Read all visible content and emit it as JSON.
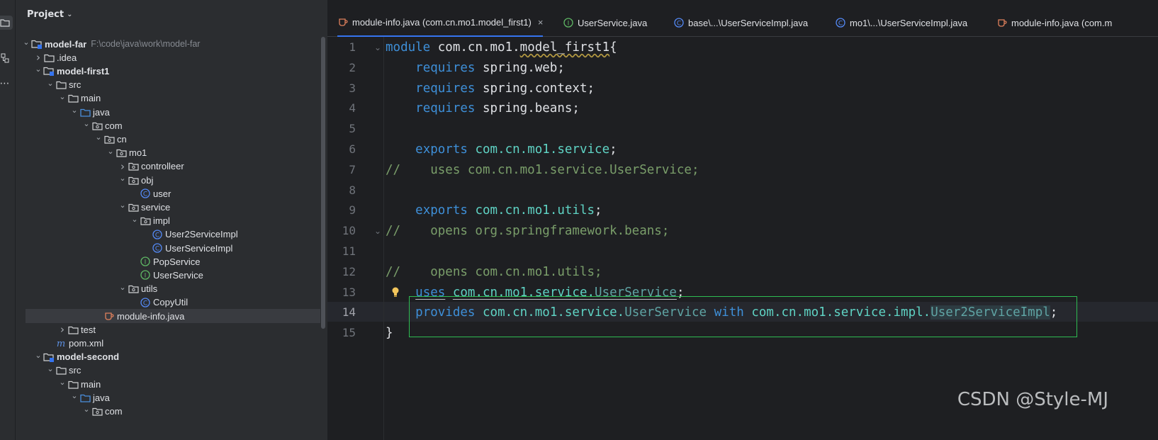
{
  "project_panel": {
    "title": "Project",
    "tree": [
      {
        "label": "model-far",
        "path": "F:\\code\\java\\work\\model-far",
        "icon": "module-folder-icon",
        "bold": true,
        "expanded": true,
        "depth": 0
      },
      {
        "label": ".idea",
        "icon": "folder-icon",
        "expanded": false,
        "depth": 1
      },
      {
        "label": "model-first1",
        "icon": "module-folder-icon",
        "bold": true,
        "expanded": true,
        "depth": 1
      },
      {
        "label": "src",
        "icon": "folder-icon",
        "expanded": true,
        "depth": 2
      },
      {
        "label": "main",
        "icon": "folder-icon",
        "expanded": true,
        "depth": 3
      },
      {
        "label": "java",
        "icon": "source-folder-icon",
        "expanded": true,
        "depth": 4
      },
      {
        "label": "com",
        "icon": "package-icon",
        "expanded": true,
        "depth": 5
      },
      {
        "label": "cn",
        "icon": "package-icon",
        "expanded": true,
        "depth": 6
      },
      {
        "label": "mo1",
        "icon": "package-icon",
        "expanded": true,
        "depth": 7
      },
      {
        "label": "controlleer",
        "icon": "package-icon",
        "expanded": false,
        "depth": 8
      },
      {
        "label": "obj",
        "icon": "package-icon",
        "expanded": true,
        "depth": 8
      },
      {
        "label": "user",
        "icon": "class-icon",
        "depth": 9
      },
      {
        "label": "service",
        "icon": "package-icon",
        "expanded": true,
        "depth": 8
      },
      {
        "label": "impl",
        "icon": "package-icon",
        "expanded": true,
        "depth": 9
      },
      {
        "label": "User2ServiceImpl",
        "icon": "class-icon",
        "depth": 10
      },
      {
        "label": "UserServiceImpl",
        "icon": "class-icon",
        "depth": 10
      },
      {
        "label": "PopService",
        "icon": "interface-icon",
        "depth": 9
      },
      {
        "label": "UserService",
        "icon": "interface-icon",
        "depth": 9
      },
      {
        "label": "utils",
        "icon": "package-icon",
        "expanded": true,
        "depth": 8
      },
      {
        "label": "CopyUtil",
        "icon": "class-icon",
        "depth": 9
      },
      {
        "label": "module-info.java",
        "icon": "module-info-icon",
        "depth": 6,
        "selected": true
      },
      {
        "label": "test",
        "icon": "folder-icon",
        "expanded": false,
        "depth": 3
      },
      {
        "label": "pom.xml",
        "icon": "maven-icon",
        "depth": 2
      },
      {
        "label": "model-second",
        "icon": "module-folder-icon",
        "bold": true,
        "expanded": true,
        "depth": 1
      },
      {
        "label": "src",
        "icon": "folder-icon",
        "expanded": true,
        "depth": 2
      },
      {
        "label": "main",
        "icon": "folder-icon",
        "expanded": true,
        "depth": 3
      },
      {
        "label": "java",
        "icon": "source-folder-icon",
        "expanded": true,
        "depth": 4
      },
      {
        "label": "com",
        "icon": "package-icon",
        "expanded": true,
        "depth": 5
      }
    ]
  },
  "tabs": [
    {
      "label": "module-info.java (com.cn.mo1.model_first1)",
      "icon": "module-info-icon",
      "active": true,
      "closable": true
    },
    {
      "label": "UserService.java",
      "icon": "interface-icon"
    },
    {
      "label": "base\\...\\UserServiceImpl.java",
      "icon": "class-icon"
    },
    {
      "label": "mo1\\...\\UserServiceImpl.java",
      "icon": "class-icon"
    },
    {
      "label": "module-info.java (com.m",
      "icon": "module-info-icon"
    }
  ],
  "editor": {
    "current_line": 14,
    "lines": [
      {
        "n": "1",
        "tokens": [
          [
            "kw2",
            "module"
          ],
          [
            "plain",
            " "
          ],
          [
            "plain",
            "com.cn.mo1."
          ],
          [
            "wav",
            "model_first1"
          ],
          [
            "plain",
            "{"
          ]
        ]
      },
      {
        "n": "2",
        "tokens": [
          [
            "plain",
            "    "
          ],
          [
            "kw2",
            "requires"
          ],
          [
            "plain",
            " spring.web;"
          ]
        ]
      },
      {
        "n": "3",
        "tokens": [
          [
            "plain",
            "    "
          ],
          [
            "kw2",
            "requires"
          ],
          [
            "plain",
            " spring.context;"
          ]
        ]
      },
      {
        "n": "4",
        "tokens": [
          [
            "plain",
            "    "
          ],
          [
            "kw2",
            "requires"
          ],
          [
            "plain",
            " spring.beans;"
          ]
        ]
      },
      {
        "n": "5",
        "tokens": []
      },
      {
        "n": "6",
        "tokens": [
          [
            "plain",
            "    "
          ],
          [
            "kw2",
            "exports"
          ],
          [
            "plain",
            " "
          ],
          [
            "pkg",
            "com.cn.mo1.service"
          ],
          [
            "plain",
            ";"
          ]
        ]
      },
      {
        "n": "7",
        "tokens": [
          [
            "cmt",
            "//    uses com.cn.mo1.service.UserService;"
          ]
        ]
      },
      {
        "n": "8",
        "tokens": []
      },
      {
        "n": "9",
        "tokens": [
          [
            "plain",
            "    "
          ],
          [
            "kw2",
            "exports"
          ],
          [
            "plain",
            " "
          ],
          [
            "pkg",
            "com.cn.mo1.utils"
          ],
          [
            "plain",
            ";"
          ]
        ]
      },
      {
        "n": "10",
        "tokens": [
          [
            "cmt",
            "//    opens org.springframework.beans;"
          ]
        ]
      },
      {
        "n": "11",
        "tokens": []
      },
      {
        "n": "12",
        "tokens": [
          [
            "cmt",
            "//    opens com.cn.mo1.utils;"
          ]
        ]
      },
      {
        "n": "13",
        "tokens": [
          [
            "plain",
            "    "
          ],
          [
            "kw2und",
            "uses"
          ],
          [
            "plain",
            " "
          ],
          [
            "pkgund",
            "com.cn.mo1.service."
          ],
          [
            "clsund",
            "UserService"
          ],
          [
            "plain",
            ";"
          ]
        ]
      },
      {
        "n": "14",
        "tokens": [
          [
            "plain",
            "    "
          ],
          [
            "kw2",
            "provides"
          ],
          [
            "plain",
            " "
          ],
          [
            "pkg",
            "com.cn.mo1.service."
          ],
          [
            "cls",
            "UserService"
          ],
          [
            "plain",
            " "
          ],
          [
            "kw2",
            "with"
          ],
          [
            "plain",
            " "
          ],
          [
            "pkg",
            "com.cn.mo1.service.impl."
          ],
          [
            "hl",
            "User2ServiceImpl"
          ],
          [
            "plain",
            ";"
          ]
        ]
      },
      {
        "n": "15",
        "tokens": [
          [
            "plain",
            "}"
          ]
        ]
      }
    ],
    "fold_markers": [
      "1",
      "10"
    ]
  },
  "watermark": "CSDN @Style-MJ",
  "colors": {
    "accent": "#3574f0",
    "highlight_box": "#2ebc52",
    "keyword": "#3e8fd8",
    "package": "#5fd3c4",
    "comment": "#7a9e6a"
  }
}
